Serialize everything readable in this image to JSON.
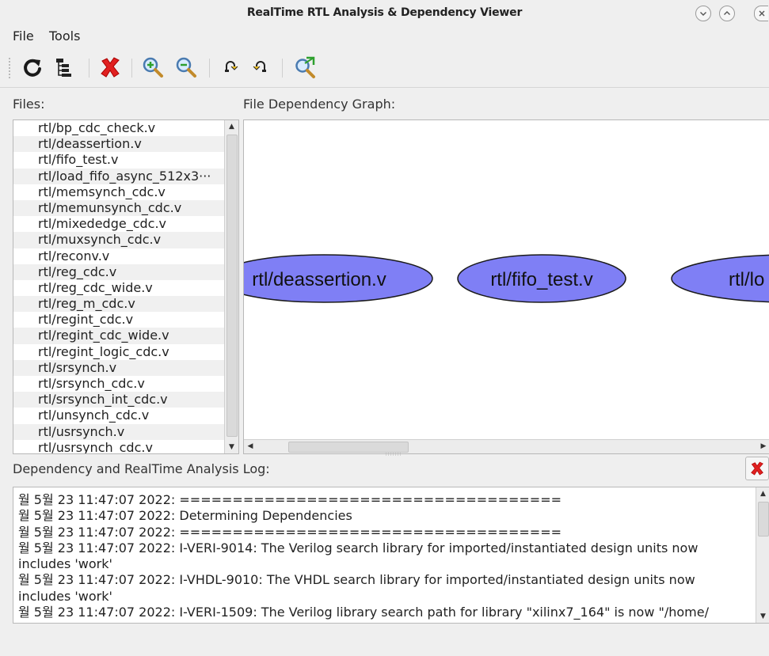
{
  "window": {
    "title": "RealTime RTL Analysis & Dependency Viewer",
    "controls": [
      "minimize",
      "maximize",
      "close"
    ]
  },
  "menubar": {
    "items": [
      {
        "label": "File",
        "mnemonic": "F"
      },
      {
        "label": "Tools",
        "mnemonic": "T"
      }
    ]
  },
  "toolbar": {
    "buttons": [
      {
        "name": "refresh",
        "icon": "refresh-icon"
      },
      {
        "name": "hierarchy",
        "icon": "hierarchy-icon"
      },
      {
        "name": "delete",
        "icon": "red-x-icon"
      },
      {
        "name": "zoom-in",
        "icon": "zoom-in-icon"
      },
      {
        "name": "zoom-out",
        "icon": "zoom-out-icon"
      },
      {
        "name": "redo",
        "icon": "redo-icon"
      },
      {
        "name": "undo",
        "icon": "undo-icon"
      },
      {
        "name": "zoom-fit",
        "icon": "zoom-fit-icon"
      }
    ]
  },
  "files": {
    "label": "Files:",
    "items": [
      "rtl/bp_cdc_check.v",
      "rtl/deassertion.v",
      "rtl/fifo_test.v",
      "rtl/load_fifo_async_512x3···",
      "rtl/memsynch_cdc.v",
      "rtl/memunsynch_cdc.v",
      "rtl/mixededge_cdc.v",
      "rtl/muxsynch_cdc.v",
      "rtl/reconv.v",
      "rtl/reg_cdc.v",
      "rtl/reg_cdc_wide.v",
      "rtl/reg_m_cdc.v",
      "rtl/regint_cdc.v",
      "rtl/regint_cdc_wide.v",
      "rtl/regint_logic_cdc.v",
      "rtl/srsynch.v",
      "rtl/srsynch_cdc.v",
      "rtl/srsynch_int_cdc.v",
      "rtl/unsynch_cdc.v",
      "rtl/usrsynch.v",
      "rtl/usrsynch_cdc.v"
    ]
  },
  "graph": {
    "label": "File Dependency Graph:",
    "node_color": "#7f7ff5",
    "nodes": [
      "rtl/deassertion.v",
      "rtl/fifo_test.v",
      "rtl/lo"
    ]
  },
  "log": {
    "label": "Dependency and RealTime Analysis Log:",
    "lines": [
      "월 5월 23 11:47:07 2022: ====================================",
      "월 5월 23 11:47:07 2022: Determining Dependencies",
      "월 5월 23 11:47:07 2022: ====================================",
      "월 5월 23 11:47:07 2022: I-VERI-9014: The Verilog search library for imported/instantiated design units now includes 'work'",
      "월 5월 23 11:47:07 2022: I-VHDL-9010: The VHDL search library for imported/instantiated design units now includes 'work'",
      "월 5월 23 11:47:07 2022: I-VERI-1509: The Verilog library search path for library \"xilinx7_164\" is now \"/home/"
    ]
  }
}
